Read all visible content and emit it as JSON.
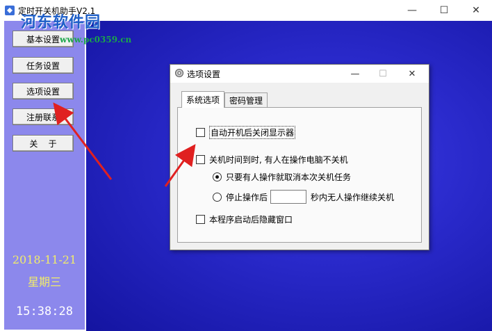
{
  "window": {
    "title": "定时开关机助手V2.1",
    "minimize_symbol": "—",
    "maximize_symbol": "☐",
    "close_symbol": "✕"
  },
  "watermark": {
    "text": "河东软件园",
    "url": "www.pc0359.cn"
  },
  "sidebar": {
    "buttons": [
      {
        "label": "基本设置"
      },
      {
        "label": "任务设置"
      },
      {
        "label": "选项设置"
      },
      {
        "label": "注册联系"
      },
      {
        "label": "关    于"
      }
    ],
    "date": "2018-11-21",
    "weekday": "星期三",
    "time": "15:38:28"
  },
  "dialog": {
    "title": "选项设置",
    "tabs": [
      {
        "label": "系统选项",
        "active": true
      },
      {
        "label": "密码管理",
        "active": false
      }
    ],
    "options": {
      "auto_off_display": {
        "label": "自动开机后关闭显示器",
        "checked": false
      },
      "no_shutdown_if_active": {
        "label": "关机时间到时, 有人在操作电脑不关机",
        "checked": false
      },
      "radio_cancel": {
        "label": "只要有人操作就取消本次关机任务",
        "selected": true
      },
      "radio_stop_prefix": "停止操作后",
      "radio_stop_suffix": "秒内无人操作继续关机",
      "radio_stop_selected": false,
      "stop_seconds_value": "",
      "hide_window": {
        "label": "本程序启动后隐藏窗口",
        "checked": false
      }
    }
  },
  "colors": {
    "sidebar_bg": "#8c88ec",
    "main_bg": "#2828c8",
    "date_color": "#f1ec6a",
    "arrow_color": "#e02020"
  }
}
